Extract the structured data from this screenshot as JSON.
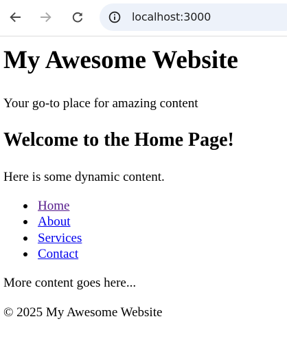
{
  "browser": {
    "url": "localhost:3000"
  },
  "header": {
    "title": "My Awesome Website",
    "tagline": "Your go-to place for amazing content"
  },
  "main": {
    "heading": "Welcome to the Home Page!",
    "dynamic_text": "Here is some dynamic content."
  },
  "nav": {
    "items": [
      {
        "label": "Home",
        "visited": true
      },
      {
        "label": "About",
        "visited": false
      },
      {
        "label": "Services",
        "visited": false
      },
      {
        "label": "Contact",
        "visited": false
      }
    ]
  },
  "more_text": "More content goes here...",
  "footer": {
    "text": "© 2025 My Awesome Website"
  },
  "colors": {
    "link": "#0000ee",
    "visited_link": "#551a8b",
    "omnibox_bg": "#edf2fa"
  },
  "icons": {
    "back": "arrow-left-icon",
    "forward": "arrow-right-icon",
    "reload": "reload-icon",
    "site_info": "info-icon"
  }
}
